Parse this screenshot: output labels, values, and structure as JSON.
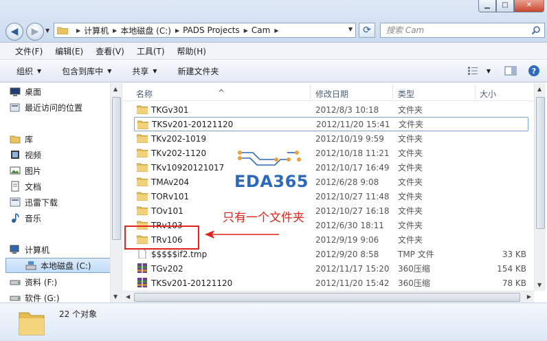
{
  "window": {
    "min_label": "▁",
    "max_label": "□",
    "close_label": "✕"
  },
  "address": {
    "crumbs": [
      "计算机",
      "本地磁盘 (C:)",
      "PADS Projects",
      "Cam"
    ]
  },
  "search": {
    "placeholder": "搜索 Cam"
  },
  "menu": [
    "文件(F)",
    "编辑(E)",
    "查看(V)",
    "工具(T)",
    "帮助(H)"
  ],
  "toolbar": {
    "organize": "组织",
    "include_library": "包含到库中",
    "share": "共享",
    "new_folder": "新建文件夹"
  },
  "sidebar": {
    "items": [
      {
        "label": "桌面",
        "icon": "desktop-icon"
      },
      {
        "label": "最近访问的位置",
        "icon": "recent-places-icon"
      },
      {
        "label": "库",
        "icon": "library-icon"
      },
      {
        "label": "视频",
        "icon": "video-library-icon"
      },
      {
        "label": "图片",
        "icon": "pictures-library-icon"
      },
      {
        "label": "文档",
        "icon": "documents-library-icon"
      },
      {
        "label": "迅雷下载",
        "icon": "download-folder-icon"
      },
      {
        "label": "音乐",
        "icon": "music-library-icon"
      },
      {
        "label": "计算机",
        "icon": "computer-icon"
      },
      {
        "label": "本地磁盘 (C:)",
        "icon": "system-drive-icon"
      },
      {
        "label": "资料 (F:)",
        "icon": "drive-icon"
      },
      {
        "label": "软件 (G:)",
        "icon": "drive-icon"
      }
    ]
  },
  "columns": {
    "name": "名称",
    "date": "修改日期",
    "type": "类型",
    "size": "大小"
  },
  "files": [
    {
      "name": "TKGv301",
      "date": "2012/8/3 10:18",
      "type": "文件夹",
      "size": "",
      "icon": "folder-icon"
    },
    {
      "name": "TKSv201-20121120",
      "date": "2012/11/20 15:41",
      "type": "文件夹",
      "size": "",
      "icon": "folder-icon"
    },
    {
      "name": "TKv202-1019",
      "date": "2012/10/19 9:59",
      "type": "文件夹",
      "size": "",
      "icon": "folder-icon"
    },
    {
      "name": "TKv202-1120",
      "date": "2012/10/18 11:21",
      "type": "文件夹",
      "size": "",
      "icon": "folder-icon"
    },
    {
      "name": "TKv10920121017",
      "date": "2012/10/17 16:49",
      "type": "文件夹",
      "size": "",
      "icon": "folder-icon"
    },
    {
      "name": "TMAv204",
      "date": "2012/6/28 9:08",
      "type": "文件夹",
      "size": "",
      "icon": "folder-icon"
    },
    {
      "name": "TORv101",
      "date": "2012/10/27 11:48",
      "type": "文件夹",
      "size": "",
      "icon": "folder-icon"
    },
    {
      "name": "TOv101",
      "date": "2012/10/27 16:18",
      "type": "文件夹",
      "size": "",
      "icon": "folder-icon"
    },
    {
      "name": "TRv103",
      "date": "2012/6/30 18:11",
      "type": "文件夹",
      "size": "",
      "icon": "folder-icon"
    },
    {
      "name": "TRv106",
      "date": "2012/9/19 9:06",
      "type": "文件夹",
      "size": "",
      "icon": "folder-icon"
    },
    {
      "name": "$$$$$if2.tmp",
      "date": "2012/9/20 8:58",
      "type": "TMP 文件",
      "size": "33 KB",
      "icon": "tmp-file-icon"
    },
    {
      "name": "TGv202",
      "date": "2012/11/17 15:20",
      "type": "360压缩",
      "size": "154 KB",
      "icon": "archive-icon"
    },
    {
      "name": "TKSv201-20121120",
      "date": "2012/11/20 15:42",
      "type": "360压缩",
      "size": "78 KB",
      "icon": "archive-icon"
    }
  ],
  "annotation": {
    "text": "只有一个文件夹",
    "color": "#e2231a"
  },
  "watermark": {
    "text": "EDA365"
  },
  "status": {
    "count": "22 个对象"
  }
}
